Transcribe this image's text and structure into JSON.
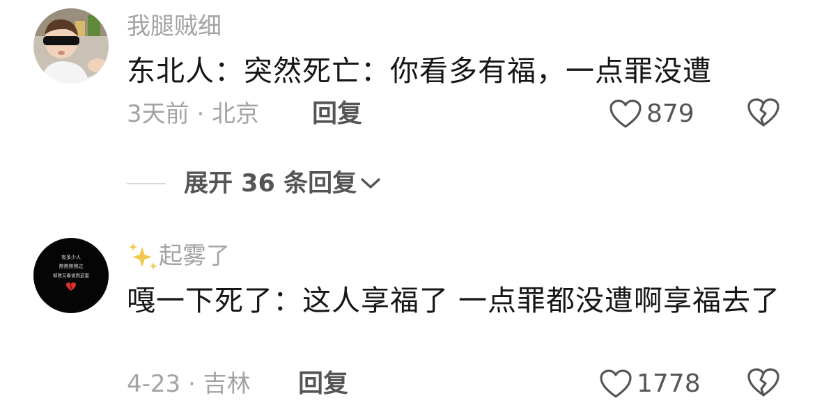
{
  "comments": [
    {
      "username": "我腿贼细",
      "text": "东北人：突然死亡：你看多有福，一点罪没遭",
      "meta": "3天前 · 北京",
      "reply_label": "回复",
      "likes": "879",
      "avatar_icon": "child-sunglasses-avatar"
    },
    {
      "username": "起雾了",
      "username_prefix_icon": "sparkles-icon",
      "text": "嘎一下死了：这人享福了 一点罪都没遭啊享福去了",
      "meta": "4-23 · 吉林",
      "reply_label": "回复",
      "likes": "1778",
      "avatar_icon": "black-text-avatar",
      "avatar_text": [
        "有多少人",
        "熬熬熬熬过",
        "却败又着说到这里"
      ]
    }
  ],
  "expand": {
    "label": "展开 36 条回复"
  },
  "colors": {
    "secondary_text": "#a3a3a3",
    "primary_text": "#161616",
    "action_text": "#555555",
    "sparkle": "#f2c94c"
  }
}
